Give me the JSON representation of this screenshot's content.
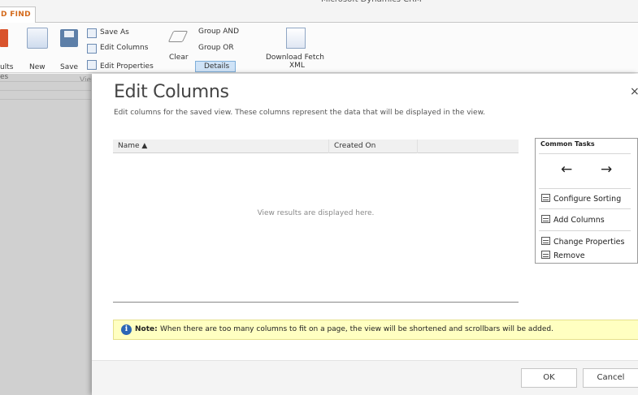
{
  "app": {
    "title": "Microsoft Dynamics CRM",
    "active_tab": "D FIND"
  },
  "ribbon": {
    "results_label": "ults",
    "new_label": "New",
    "save_label": "Save",
    "save_as_label": "Save As",
    "edit_columns_label": "Edit Columns",
    "edit_properties_label": "Edit Properties",
    "clear_label": "Clear",
    "group_and_label": "Group AND",
    "group_or_label": "Group OR",
    "details_label": "Details",
    "download_fetch_label": "Download Fetch",
    "download_fetch_label2": "XML",
    "view_group_label": "Vie"
  },
  "left_list": {
    "rows": [
      "es",
      "",
      ""
    ]
  },
  "dialog": {
    "title": "Edit Columns",
    "subtitle": "Edit columns for the saved view. These columns represent the data that will be displayed in the view.",
    "close_glyph": "×",
    "grid": {
      "columns": [
        "Name ▲",
        "Created On",
        ""
      ],
      "empty_message": "View results are displayed here."
    },
    "common_tasks": {
      "title": "Common Tasks",
      "left_arrow": "←",
      "right_arrow": "→",
      "items": [
        "Configure Sorting",
        "Add Columns",
        "Change Properties",
        "Remove"
      ]
    },
    "note": {
      "label": "Note:",
      "text": "When there are too many columns to fit on a page, the view will be shortened and scrollbars will be added."
    },
    "buttons": {
      "ok": "OK",
      "cancel": "Cancel"
    }
  }
}
